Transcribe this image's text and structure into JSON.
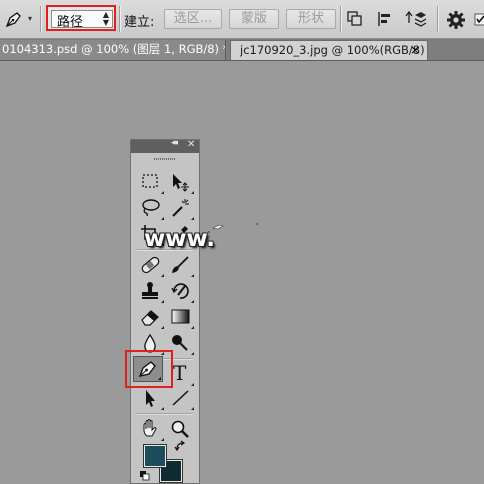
{
  "options_bar": {
    "mode_value": "路径",
    "make_label": "建立:",
    "selection_button": "选区...",
    "mask_button": "蒙版",
    "shape_button": "形状"
  },
  "tabs": [
    {
      "label": "0104313.psd @ 100% (图层 1, RGB/8) *"
    },
    {
      "label": "jc170920_3.jpg @ 100%(RGB/8)"
    }
  ],
  "tabs_close_glyph": "×",
  "tools_panel": {
    "collapse_glyph": "◂◂",
    "close_glyph": "✕",
    "type_tool_glyph": "T"
  },
  "colors": {
    "highlight": "#e0201b",
    "foreground_swatch": "#1d4d5c",
    "background_swatch": "#0f2a33",
    "canvas": "#9a9a9a"
  },
  "watermark": "www."
}
